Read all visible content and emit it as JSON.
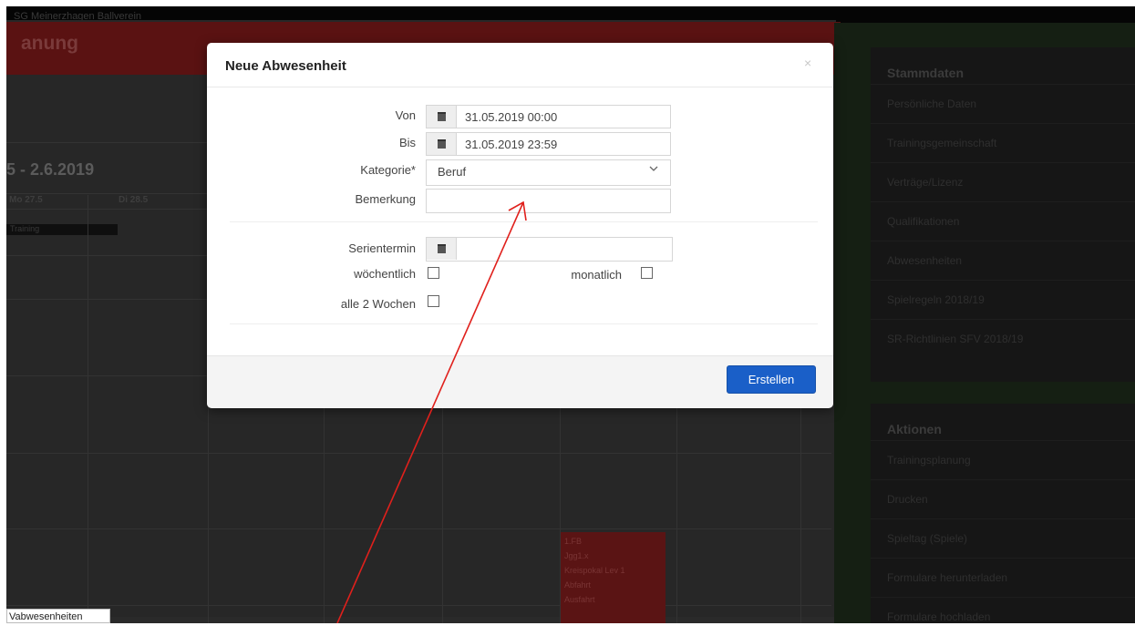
{
  "background": {
    "topbar_text": "SG Meinerzhagen Ballverein",
    "planner_title": "anung",
    "week_range": "5 - 2.6.2019",
    "day_headers": [
      "Mo 27.5",
      "Di 28.5"
    ],
    "event_band": "Training",
    "event_block_lines": [
      "1.FB",
      "Jgg1.x",
      "Kreispokal Lev 1",
      "Abfahrt",
      "Ausfahrt"
    ],
    "tooltip": "Vabwesenheiten"
  },
  "right_sidebar": {
    "stammdaten": {
      "title": "Stammdaten",
      "items": [
        "Persönliche Daten",
        "Trainingsgemeinschaft",
        "Verträge/Lizenz",
        "Qualifikationen",
        "Abwesenheiten",
        "Spielregeln 2018/19",
        "SR-Richtlinien SFV 2018/19"
      ]
    },
    "aktionen": {
      "title": "Aktionen",
      "items": [
        "Trainingsplanung",
        "Drucken",
        "Spieltag (Spiele)",
        "Formulare herunterladen",
        "Formulare hochladen"
      ]
    }
  },
  "modal": {
    "title": "Neue Abwesenheit",
    "close": "×",
    "fields": {
      "von_label": "Von",
      "von_value": "31.05.2019 00:00",
      "bis_label": "Bis",
      "bis_value": "31.05.2019 23:59",
      "kategorie_label": "Kategorie*",
      "kategorie_value": "Beruf",
      "bemerkung_label": "Bemerkung",
      "bemerkung_value": "",
      "serientermin_label": "Serientermin",
      "serientermin_value": "",
      "woechentlich_label": "wöchentlich",
      "monatlich_label": "monatlich",
      "alle2_label": "alle 2 Wochen"
    },
    "submit_label": "Erstellen"
  },
  "colors": {
    "primary_button": "#1a5fc8",
    "annotation_arrow": "#e0201c"
  }
}
